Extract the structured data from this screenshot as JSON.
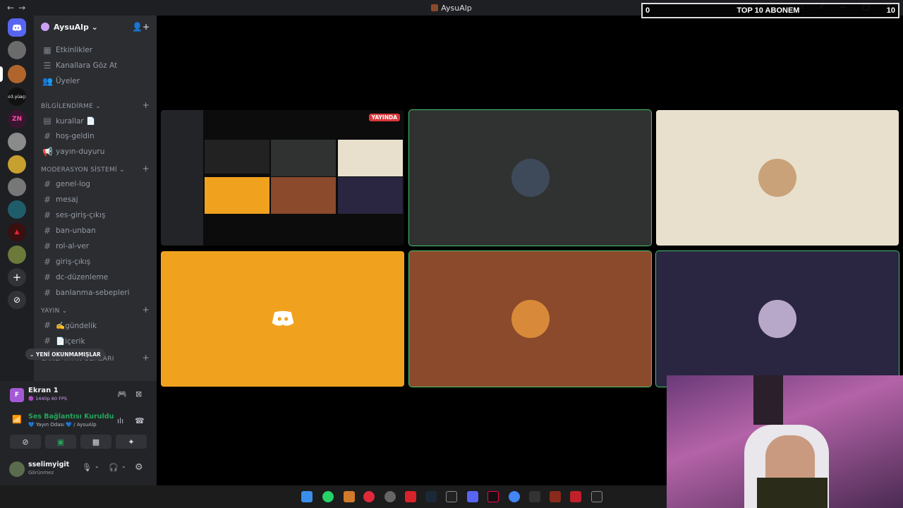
{
  "window": {
    "title": "AysuAlp",
    "back": "←",
    "forward": "→"
  },
  "overlay_counter": {
    "left": "0",
    "label": "TOP 10 ABONEM",
    "right": "10"
  },
  "rail": {
    "small_server_label": "o3.yüaçı"
  },
  "server": {
    "name": "AysuAlp ⌄"
  },
  "top_links": [
    {
      "label": "Etkinlikler"
    },
    {
      "label": "Kanallara Göz At"
    },
    {
      "label": "Üyeler"
    }
  ],
  "categories": [
    {
      "name": "BİLGİLENDİRME ⌄",
      "channels": [
        "kurallar 📄",
        "hoş-geldin",
        "yayın-duyuru"
      ]
    },
    {
      "name": "MODERASYON SİSTEMİ ⌄",
      "channels": [
        "genel-log",
        "mesaj",
        "ses-giriş-çıkış",
        "ban-unban",
        "rol-al-ver",
        "giriş-çıkış",
        "dc-düzenleme",
        "banlanma-sebepleri"
      ]
    },
    {
      "name": "YAYIN ⌄",
      "channels": [
        "✍️gündelik",
        "📄içerik"
      ]
    },
    {
      "name": "CANLI YAYIN ODALARI"
    }
  ],
  "unread_button": "⌄ YENİ OKUNMAMIŞLAR",
  "stream": {
    "name": "Ekran 1",
    "quality": "🟣 1440p 60 FPS",
    "badge": "F"
  },
  "voice": {
    "status": "Ses Bağlantısı Kuruldu",
    "location": "💙 Yayın Odası 💙 / AysuAlp"
  },
  "user": {
    "name": "sselimyigit",
    "status": "Görünmez"
  },
  "live_badge": "YAYINDA",
  "colors": {
    "tile_dark": "#2f3231",
    "tile_cream": "#e8e0cc",
    "tile_orange": "#f0a21f",
    "tile_brown": "#8b4a2c",
    "tile_navy": "#2a2540",
    "speaking": "#46c46e",
    "voice_green": "#23a55a"
  }
}
